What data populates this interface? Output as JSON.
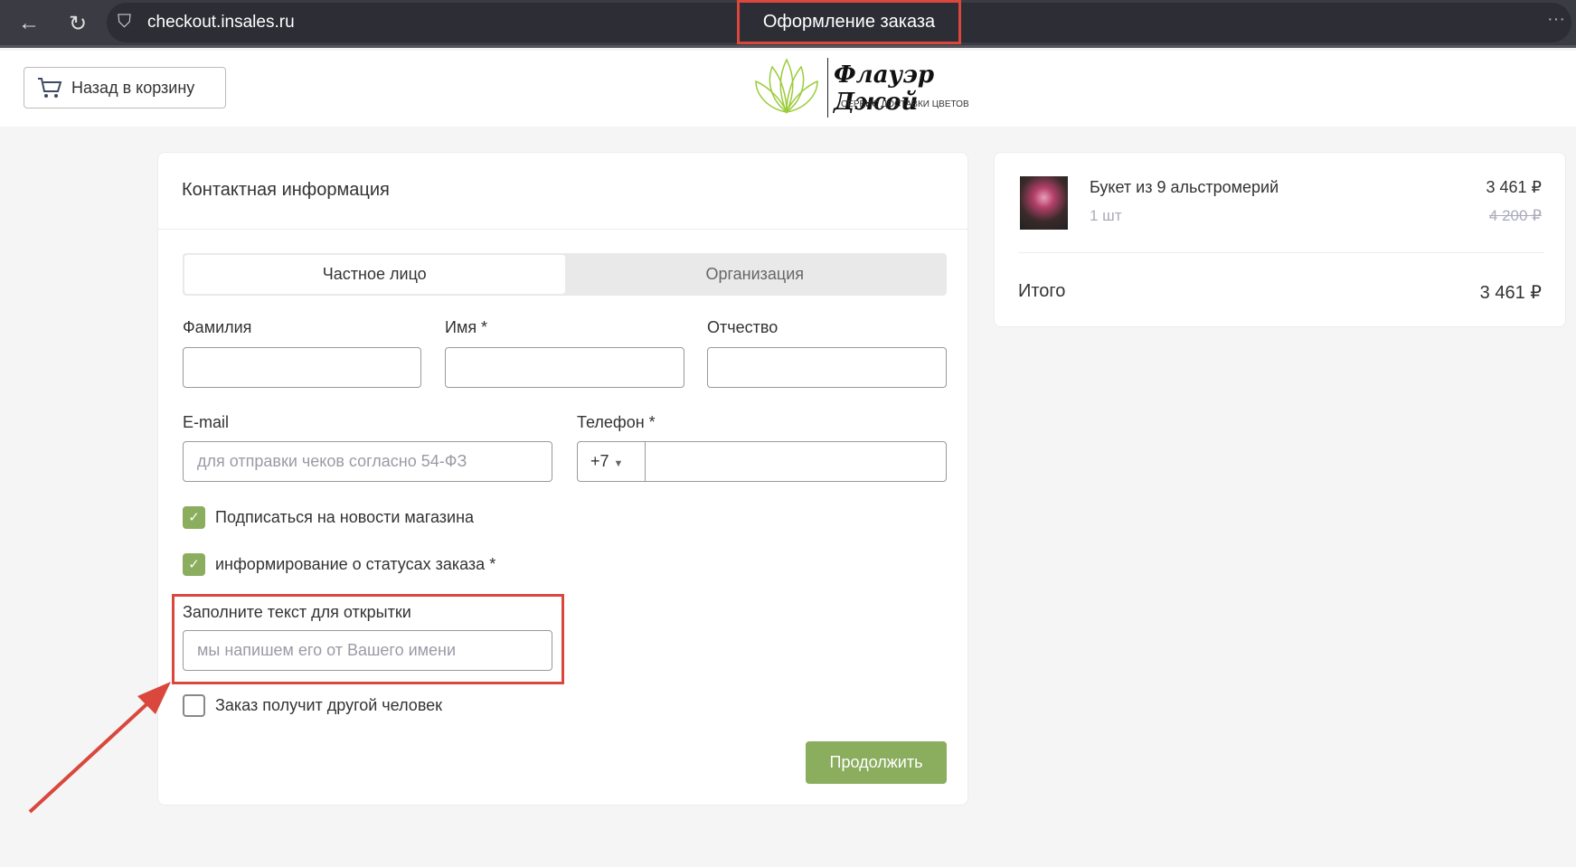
{
  "browser": {
    "url": "checkout.insales.ru",
    "title": "Оформление заказа"
  },
  "header": {
    "back_label": "Назад в корзину",
    "logo_name": "Флауэр Джой",
    "logo_sub": "СЕРВИС ДОСТАВКИ ЦВЕТОВ"
  },
  "form": {
    "title": "Контактная информация",
    "tabs": [
      "Частное лицо",
      "Организация"
    ],
    "last_name_label": "Фамилия",
    "first_name_label": "Имя *",
    "middle_name_label": "Отчество",
    "email_label": "E-mail",
    "email_placeholder": "для отправки чеков согласно  54-ФЗ",
    "phone_label": "Телефон *",
    "phone_prefix": "+7",
    "subscribe_label": "Подписаться на новости магазина",
    "status_label": "информирование о статусах заказа *",
    "card_text_label": "Заполните текст для открытки",
    "card_text_placeholder": "мы напишем его от Вашего имени",
    "other_person_label": "Заказ получит другой человек",
    "continue_label": "Продолжить"
  },
  "summary": {
    "item_name": "Букет из 9 альстромерий",
    "item_qty": "1 шт",
    "item_price": "3 461 ₽",
    "item_old_price": "4 200 ₽",
    "total_label": "Итого",
    "total_value": "3 461 ₽"
  },
  "colors": {
    "accent": "#8aad5e",
    "highlight": "#d9473d"
  }
}
